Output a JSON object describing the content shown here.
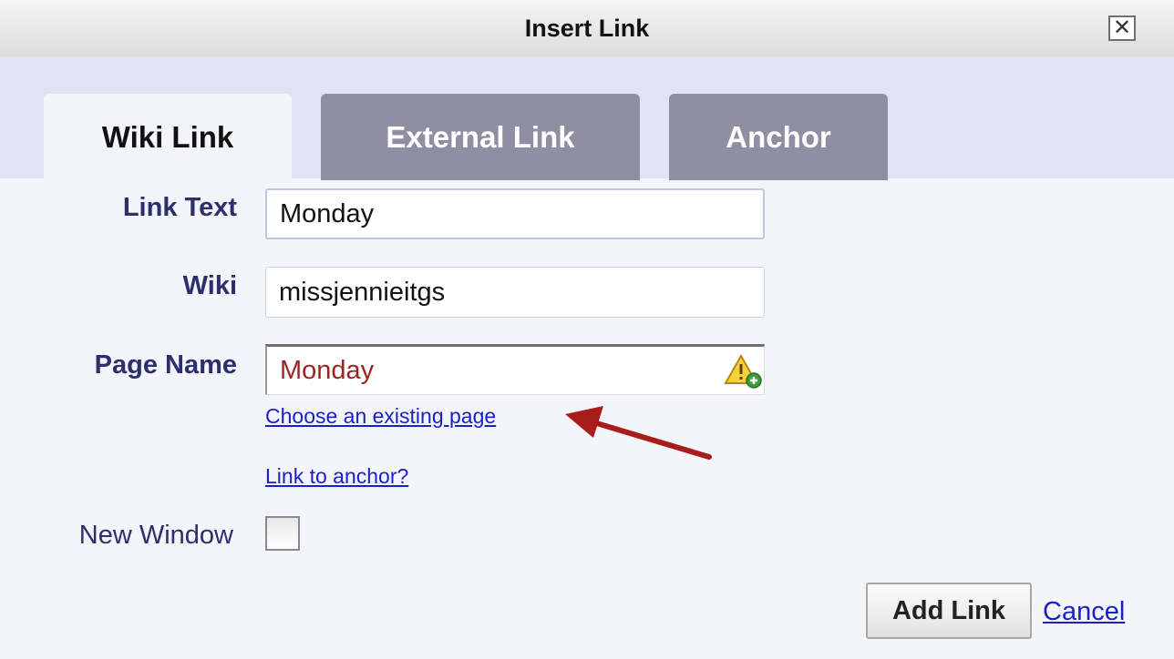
{
  "dialog": {
    "title": "Insert Link",
    "close_icon": "close-icon"
  },
  "tabs": [
    {
      "label": "Wiki Link",
      "active": true
    },
    {
      "label": "External Link",
      "active": false
    },
    {
      "label": "Anchor",
      "active": false
    }
  ],
  "form": {
    "link_text": {
      "label": "Link Text",
      "value": "Monday"
    },
    "wiki": {
      "label": "Wiki",
      "value": "missjennieitgs"
    },
    "page_name": {
      "label": "Page Name",
      "value": "Monday",
      "status_icon": "warning-add-icon"
    },
    "choose_page_link": "Choose an existing page",
    "anchor_link": "Link to anchor?",
    "new_window": {
      "label": "New Window",
      "checked": false
    }
  },
  "buttons": {
    "add_link": "Add Link",
    "cancel": "Cancel"
  },
  "annotation": {
    "arrow_color": "#a81c1c",
    "points_to": "choose-existing-page-link"
  },
  "colors": {
    "label": "#2b2f6e",
    "link": "#1a21c6",
    "tab_inactive": "#8f8ea3",
    "page_name_value": "#9c2524"
  }
}
